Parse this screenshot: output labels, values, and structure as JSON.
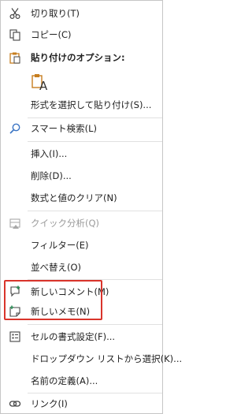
{
  "menu": {
    "cut": "切り取り(T)",
    "copy": "コピー(C)",
    "paste_options_header": "貼り付けのオプション:",
    "paste_option_letter": "A",
    "paste_special": "形式を選択して貼り付け(S)...",
    "smart_lookup": "スマート検索(L)",
    "insert": "挿入(I)...",
    "delete": "削除(D)...",
    "clear_contents": "数式と値のクリア(N)",
    "quick_analysis": "クイック分析(Q)",
    "filter": "フィルター(E)",
    "sort": "並べ替え(O)",
    "new_comment": "新しいコメント(M)",
    "new_note": "新しいメモ(N)",
    "format_cells": "セルの書式設定(F)...",
    "dropdown_pick": "ドロップダウン リストから選択(K)...",
    "define_name": "名前の定義(A)...",
    "link": "リンク(I)"
  },
  "colors": {
    "accent_icon": "#3a74c4",
    "clipboard_orange": "#c77e1f",
    "comment_green": "#2e8b57",
    "highlight_red": "#d9342b"
  }
}
